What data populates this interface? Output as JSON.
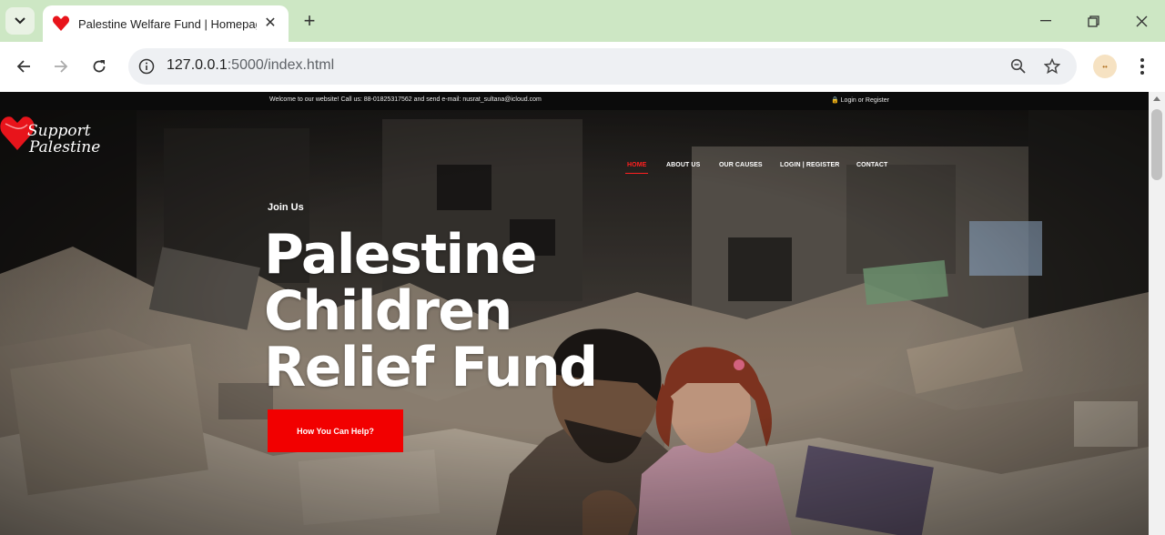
{
  "browser": {
    "tab_title": "Palestine Welfare Fund | Homepage",
    "url_host": "127.0.0.1",
    "url_rest": ":5000/index.html",
    "icons": [
      "tab-search-icon",
      "heart-favicon-icon",
      "close-icon",
      "plus-icon",
      "minimize-icon",
      "restore-icon",
      "window-close-icon",
      "back-icon",
      "forward-icon",
      "reload-icon",
      "info-icon",
      "zoom-icon",
      "star-icon",
      "profile-icon",
      "menu-icon"
    ]
  },
  "page": {
    "topbar": {
      "welcome": "Welcome to our website! Call us: 88-01825317562 and send e-mail: nusrat_sultana@icloud.com",
      "login": "🔒 Login or Register"
    },
    "logo_text": "Support Palestine",
    "nav": [
      "HOME",
      "ABOUT US",
      "OUR CAUSES",
      "LOGIN | REGISTER",
      "CONTACT"
    ],
    "hero": {
      "kicker": "Join Us",
      "headline": [
        "Palestine",
        "Children",
        "Relief Fund"
      ],
      "cta": "How You Can Help?"
    },
    "colors": {
      "accent": "#f20000",
      "nav_active": "#ff2020",
      "tabbar": "#cde7c4"
    }
  }
}
